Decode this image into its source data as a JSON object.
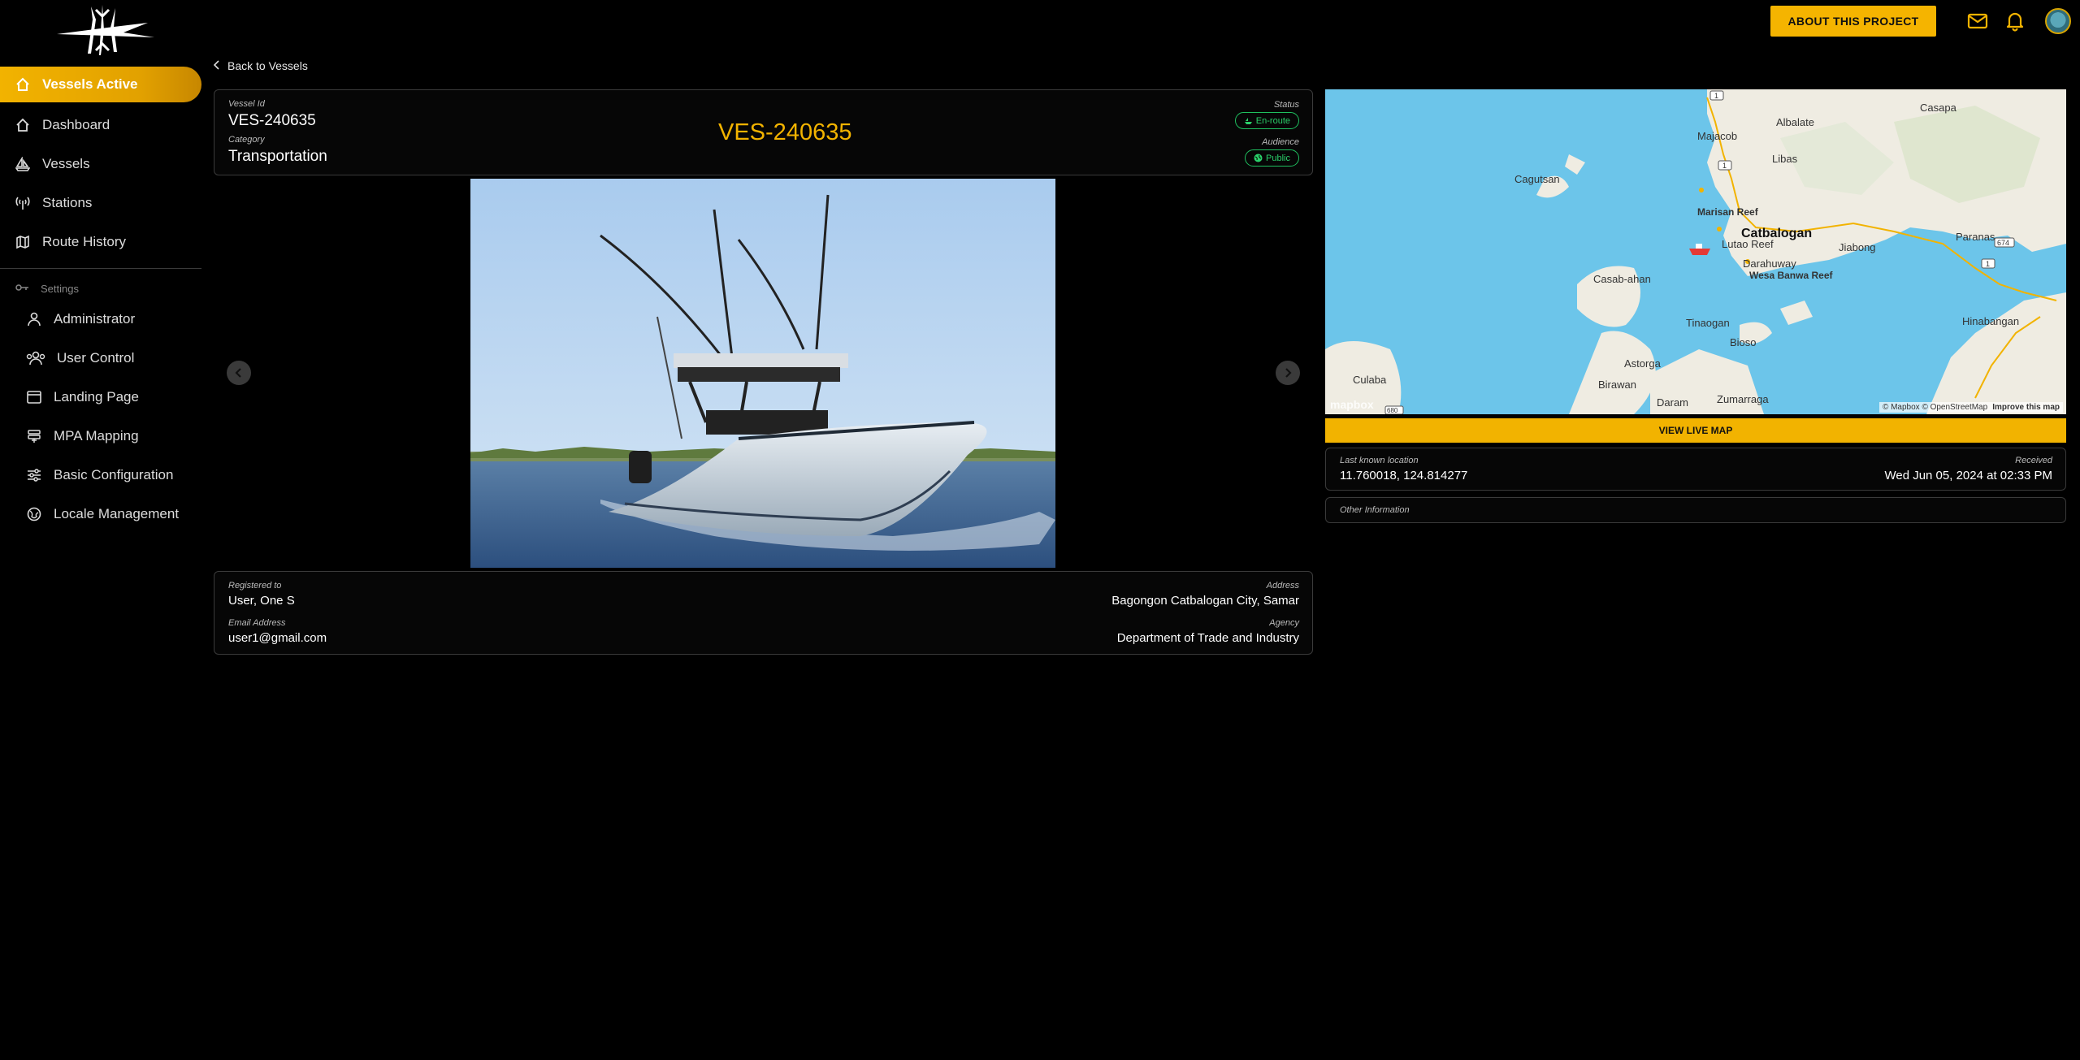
{
  "header": {
    "about_button": "ABOUT THIS PROJECT",
    "icons": [
      "mail-icon",
      "bell-icon",
      "avatar"
    ]
  },
  "sidebar": {
    "items": [
      {
        "label": "Vessels Active",
        "icon": "home-icon",
        "active": true
      },
      {
        "label": "Dashboard",
        "icon": "home-icon"
      },
      {
        "label": "Vessels",
        "icon": "sailboat-icon"
      },
      {
        "label": "Stations",
        "icon": "antenna-icon"
      },
      {
        "label": "Route History",
        "icon": "map-icon"
      }
    ],
    "settings_label": "Settings",
    "settings_items": [
      {
        "label": "Administrator",
        "icon": "user-icon"
      },
      {
        "label": "User Control",
        "icon": "users-icon"
      },
      {
        "label": "Landing Page",
        "icon": "window-icon"
      },
      {
        "label": "MPA Mapping",
        "icon": "layers-icon"
      },
      {
        "label": "Basic Configuration",
        "icon": "sliders-icon"
      },
      {
        "label": "Locale Management",
        "icon": "globe-icon"
      }
    ]
  },
  "back_link": "Back to Vessels",
  "vessel": {
    "id_label": "Vessel Id",
    "id": "VES-240635",
    "title": "VES-240635",
    "category_label": "Category",
    "category": "Transportation",
    "status_label": "Status",
    "status": "En-route",
    "audience_label": "Audience",
    "audience": "Public"
  },
  "owner": {
    "registered_label": "Registered to",
    "registered": "User, One S",
    "email_label": "Email Address",
    "email": "user1@gmail.com",
    "address_label": "Address",
    "address": "Bagongon Catbalogan City, Samar",
    "agency_label": "Agency",
    "agency": "Department of Trade and Industry"
  },
  "map": {
    "places": [
      "Casapa",
      "Albalate",
      "Majacob",
      "Libas",
      "Cagutsan",
      "Marisan Reef",
      "Catbalogan",
      "Lutao Reef",
      "Jiabong",
      "Paranas",
      "Darahuway",
      "Wesa Banwa Reef",
      "Casab-ahan",
      "Tinaogan",
      "Hinabangan",
      "Bioso",
      "Astorga",
      "Culaba",
      "Birawan",
      "Daram",
      "Zumarraga"
    ],
    "road_badges": [
      "1",
      "1",
      "674",
      "1",
      "680"
    ],
    "attribution": "© Mapbox © OpenStreetMap",
    "improve": "Improve this map",
    "brand": "mapbox",
    "button": "VIEW LIVE MAP"
  },
  "location": {
    "label": "Last known location",
    "coords": "11.760018, 124.814277",
    "received_label": "Received",
    "received": "Wed Jun 05, 2024 at 02:33 PM"
  },
  "other_info": "Other Information"
}
